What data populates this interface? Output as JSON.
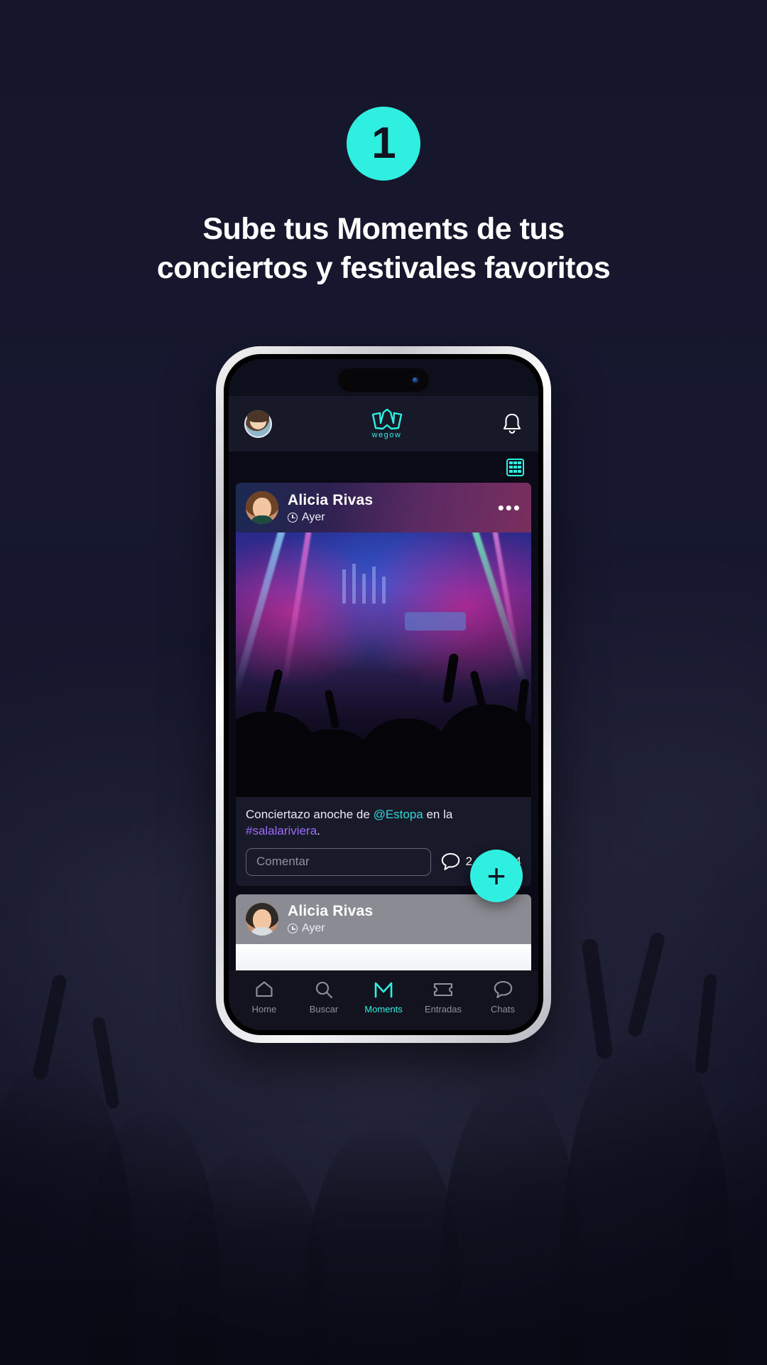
{
  "promo": {
    "step_badge": "1",
    "headline_line1": "Sube tus Moments de tus",
    "headline_line2": "conciertos y festivales favoritos",
    "accent_color": "#2ff0e0",
    "background_color": "#15162a"
  },
  "app": {
    "header": {
      "avatar": "user-avatar",
      "logo_wordmark": "wegow",
      "notifications_icon": "bell-icon"
    },
    "toolbar": {
      "grid_view_icon": "grid-icon"
    },
    "posts": [
      {
        "author": "Alicia Rivas",
        "time": "Ayer",
        "time_icon": "clock-icon",
        "menu_icon": "more-options-icon",
        "caption_prefix": "Conciertazo anoche de ",
        "caption_mention": "@Estopa",
        "caption_middle": " en la ",
        "caption_hashtag": "#salalariviera",
        "caption_suffix": ".",
        "comment_placeholder": "Comentar",
        "comment_count": "2",
        "like_count": "34",
        "comment_icon": "comment-bubble-icon",
        "like_icon": "heart-icon"
      },
      {
        "author": "Alicia Rivas",
        "time": "Ayer",
        "time_icon": "clock-icon"
      }
    ],
    "fab": {
      "label": "+",
      "icon": "plus-icon",
      "color": "#2ff0e0"
    },
    "nav": [
      {
        "label": "Home",
        "icon": "home-icon",
        "active": false
      },
      {
        "label": "Buscar",
        "icon": "search-icon",
        "active": false
      },
      {
        "label": "Moments",
        "icon": "moments-icon",
        "active": true
      },
      {
        "label": "Entradas",
        "icon": "ticket-icon",
        "active": false
      },
      {
        "label": "Chats",
        "icon": "chat-icon",
        "active": false
      }
    ]
  }
}
